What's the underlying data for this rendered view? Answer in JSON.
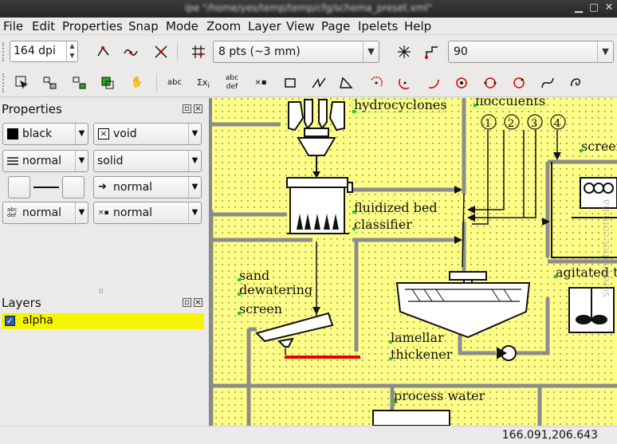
{
  "window": {
    "title": "ipe \"/home/yes/temp/temp/cfg/schema_preset.xml\""
  },
  "menu": [
    "File",
    "Edit",
    "Properties",
    "Snap",
    "Mode",
    "Zoom",
    "Layer",
    "View",
    "Page",
    "Ipelets",
    "Help"
  ],
  "toolbar": {
    "resolution": "164 dpi",
    "grid_size": "8 pts (~3 mm)",
    "angle": "90"
  },
  "properties_panel": {
    "title": "Properties",
    "stroke_color": "black",
    "fill_color": "void",
    "pen_width": "normal",
    "dash_style": "solid",
    "arrow": "normal",
    "text_size": "normal",
    "mark_size": "normal"
  },
  "layers_panel": {
    "title": "Layers",
    "layers": [
      {
        "name": "alpha",
        "checked": true
      }
    ]
  },
  "canvas": {
    "labels": {
      "hydrocyclones": "hydrocyclones",
      "flocculents": "flocculents",
      "fluidized_bed": "fluidized bed",
      "classifier": "classifier",
      "sand": "sand",
      "dewatering": "dewatering",
      "screen": "screen",
      "lamellar": "lamellar",
      "thickener": "thickener",
      "process_water": "process water",
      "agitated": "agitated t",
      "screen_right": "screen"
    },
    "flocculent_numbers": [
      "1",
      "2",
      "3",
      "4"
    ],
    "watermark": "screenshot.com.na"
  },
  "status": {
    "coordinates": "166.091,206.643"
  },
  "colors": {
    "canvas_bg": "#ffff88",
    "layer_highlight": "#f5f500",
    "pipe": "#8c8c8c"
  }
}
